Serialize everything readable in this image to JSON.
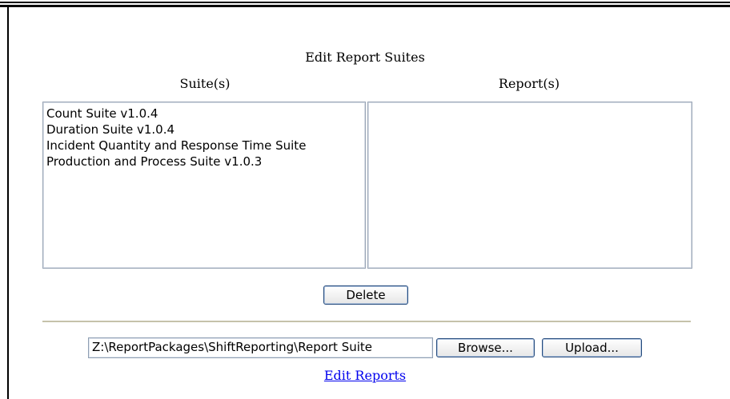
{
  "page": {
    "title": "Edit Report Suites",
    "suites_header": "Suite(s)",
    "reports_header": "Report(s)"
  },
  "suites": {
    "items": [
      {
        "label": "Count Suite v1.0.4"
      },
      {
        "label": "Duration Suite v1.0.4"
      },
      {
        "label": "Incident Quantity and Response Time Suite"
      },
      {
        "label": "Production and Process Suite v1.0.3"
      }
    ]
  },
  "reports": {
    "items": []
  },
  "actions": {
    "delete_label": "Delete",
    "browse_label": "Browse...",
    "upload_label": "Upload..."
  },
  "file": {
    "value": "Z:\\ReportPackages\\ShiftReporting\\Report Suite"
  },
  "links": {
    "edit_reports": "Edit Reports"
  }
}
